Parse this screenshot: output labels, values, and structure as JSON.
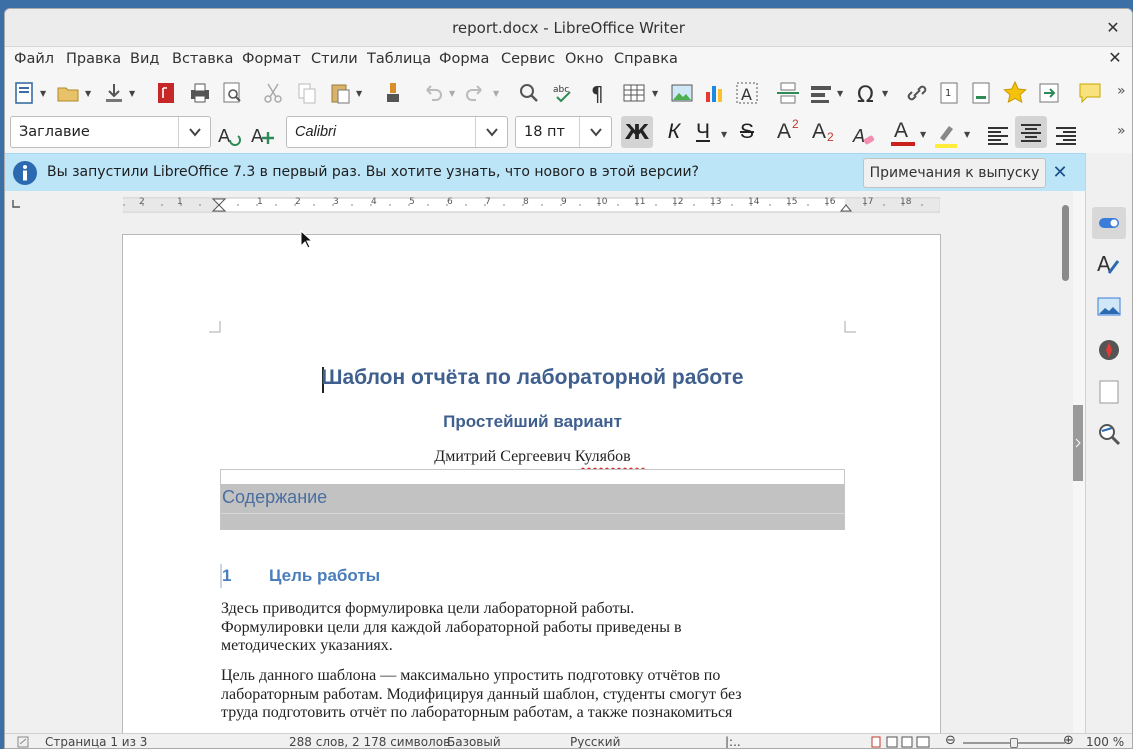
{
  "window": {
    "title": "report.docx - LibreOffice Writer"
  },
  "menu": [
    "Файл",
    "Правка",
    "Вид",
    "Вставка",
    "Формат",
    "Стили",
    "Таблица",
    "Форма",
    "Сервис",
    "Окно",
    "Справка"
  ],
  "format": {
    "style": "Заглавие",
    "font": "Calibri",
    "size": "18 пт",
    "bold": "Ж",
    "italic": "К",
    "underline": "Ч",
    "strike": "S",
    "superscript": "A",
    "sup_mark": "2",
    "subscript": "A",
    "sub_mark": "2",
    "font_color_label": "A"
  },
  "infobar": {
    "text": "Вы запустили LibreOffice 7.3 в первый раз. Вы хотите узнать, что нового в этой версии?",
    "button": "Примечания к выпуску"
  },
  "ruler": {
    "left_labels": [
      "2",
      "1"
    ],
    "right_labels": [
      "1",
      "2",
      "3",
      "4",
      "5",
      "6",
      "7",
      "8",
      "9",
      "10",
      "11",
      "12",
      "13",
      "14",
      "15",
      "16",
      "17",
      "18"
    ]
  },
  "document": {
    "title": "Шаблон отчёта по лабораторной работе",
    "subtitle": "Простейший вариант",
    "author": "Дмитрий Сергеевич Кулябов",
    "toc_heading": "Содержание",
    "section_number": "1",
    "section_title": "Цель работы",
    "p1": [
      "Здесь приводится формулировка цели лабораторной работы.",
      "Формулировки цели для каждой лабораторной работы приведены в",
      "методических указаниях."
    ],
    "p2": [
      "Цель данного шаблона — максимально упростить подготовку отчётов по",
      "лабораторным работам. Модифицируя данный шаблон, студенты смогут без",
      "труда подготовить отчёт по лабораторным работам, а также познакомиться"
    ]
  },
  "status": {
    "page": "Страница 1 из 3",
    "words": "288 слов, 2 178 символов",
    "page_style": "Базовый",
    "language": "Русский",
    "zoom": "100 %"
  },
  "colors": {
    "heading": "#3f5f8f",
    "section": "#4a7ebb",
    "infobar": "#bde5f8",
    "accent_red": "#c0392b"
  }
}
